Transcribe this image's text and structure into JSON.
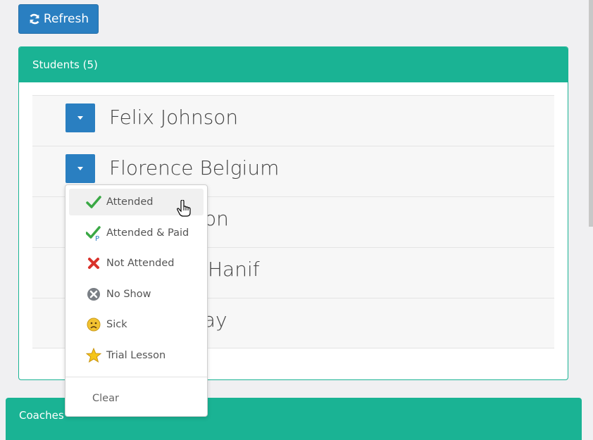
{
  "toolbar": {
    "refresh_label": "Refresh"
  },
  "students_panel": {
    "title": "Students (5)",
    "students": [
      {
        "name": "Felix Johnson"
      },
      {
        "name": "Florence Belgium"
      },
      {
        "name": "ton"
      },
      {
        "name": "Hanif"
      },
      {
        "name": "lay"
      }
    ]
  },
  "attendance_menu": {
    "items": [
      {
        "label": "Attended",
        "icon": "check-icon"
      },
      {
        "label": "Attended & Paid",
        "icon": "check-paid-icon"
      },
      {
        "label": "Not Attended",
        "icon": "red-x-icon"
      },
      {
        "label": "No Show",
        "icon": "gray-x-circle-icon"
      },
      {
        "label": "Sick",
        "icon": "sad-face-icon"
      },
      {
        "label": "Trial Lesson",
        "icon": "star-icon"
      }
    ],
    "clear_label": "Clear"
  },
  "coaches_panel": {
    "title": "Coaches"
  },
  "colors": {
    "accent": "#1ab394",
    "button": "#2a7fc1"
  }
}
